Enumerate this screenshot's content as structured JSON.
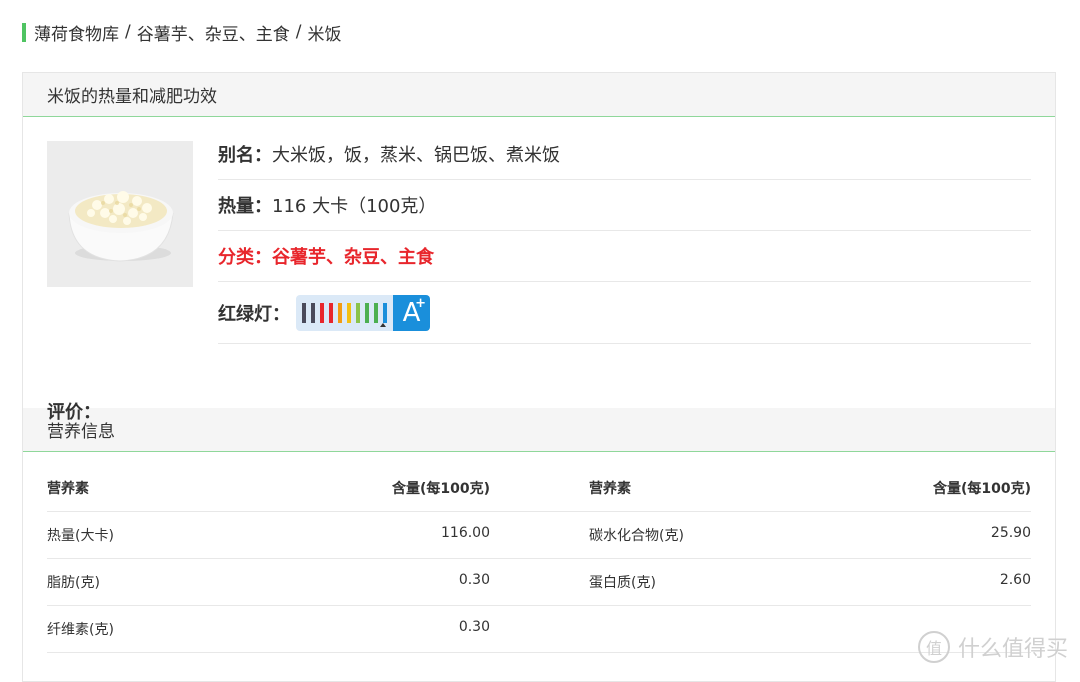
{
  "breadcrumb": {
    "root": "薄荷食物库",
    "category": "谷薯芋、杂豆、主食",
    "current": "米饭",
    "separator": "/"
  },
  "detail_section": {
    "title": "米饭的热量和减肥功效",
    "image_alt": "米饭",
    "alias_label": "别名：",
    "alias_value": "大米饭，饭，蒸米、锅巴饭、煮米饭",
    "calorie_label": "热量：",
    "calorie_value": "116 大卡（100克）",
    "category_label": "分类：",
    "category_value": "谷薯芋、杂豆、主食",
    "traffic_light_label": "红绿灯：",
    "traffic_light_grade": "A",
    "traffic_light_bars": [
      "#4a4a5a",
      "#4a4a5a",
      "#e8262c",
      "#e8262c",
      "#f39c12",
      "#f3c012",
      "#8bc34a",
      "#4caf50",
      "#4caf50",
      "#1a8fdb"
    ],
    "rating_label": "评价："
  },
  "nutrition_section": {
    "title": "营养信息",
    "headers": {
      "nutrient": "营养素",
      "amount": "含量(每100克)"
    },
    "rows": [
      {
        "left_name": "热量(大卡)",
        "left_value": "116.00",
        "right_name": "碳水化合物(克)",
        "right_value": "25.90"
      },
      {
        "left_name": "脂肪(克)",
        "left_value": "0.30",
        "right_name": "蛋白质(克)",
        "right_value": "2.60"
      },
      {
        "left_name": "纤维素(克)",
        "left_value": "0.30",
        "right_name": "",
        "right_value": ""
      }
    ]
  },
  "watermark": {
    "icon_text": "值",
    "text": "什么值得买"
  },
  "colors": {
    "accent_green": "#4fc462",
    "category_red": "#e8262c",
    "grade_blue": "#1a8fdb"
  }
}
